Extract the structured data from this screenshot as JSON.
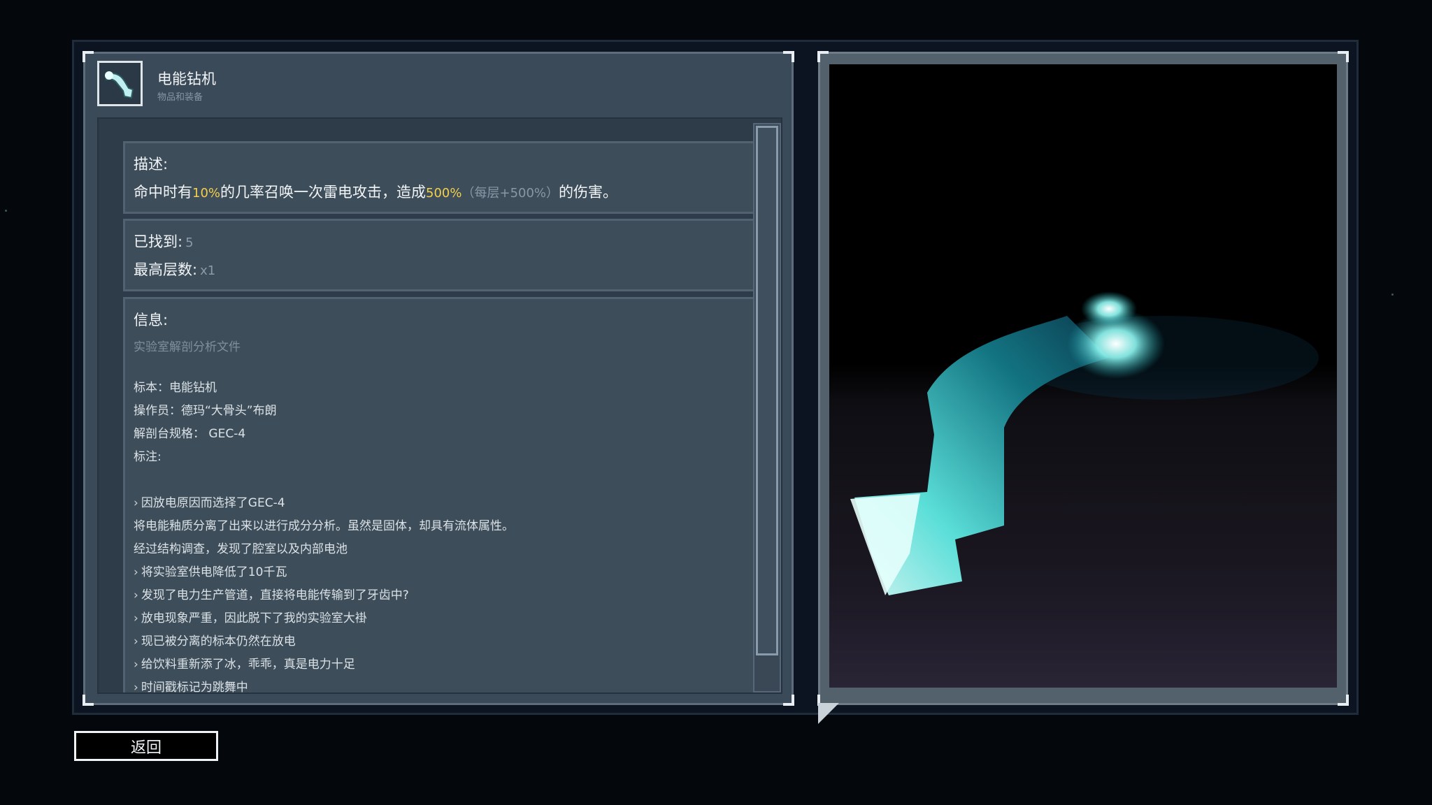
{
  "item": {
    "title": "电能钻机",
    "subtitle": "物品和装备",
    "icon": "electric-drill-icon"
  },
  "description": {
    "heading": "描述:",
    "text_a": "命中时有",
    "chance": "10%",
    "text_b": "的几率召唤一次雷电攻击，造成",
    "damage": "500%",
    "stack": "（每层+500%）",
    "text_c": "的伤害。"
  },
  "stats": {
    "found_label": "已找到:",
    "found_value": "5",
    "max_stack_label": "最高层数:",
    "max_stack_value": "x1"
  },
  "info": {
    "heading": "信息:",
    "subtitle": "实验室解剖分析文件",
    "lines": [
      "标本：电能钻机",
      "操作员：德玛“大骨头”布朗",
      "解剖台规格： GEC-4",
      "标注:"
    ],
    "notes": [
      {
        "arrow": true,
        "text": "因放电原因而选择了GEC-4"
      },
      {
        "arrow": false,
        "text": "将电能釉质分离了出来以进行成分分析。虽然是固体，却具有流体属性。"
      },
      {
        "arrow": false,
        "text": "经过结构调查，发现了腔室以及内部电池"
      },
      {
        "arrow": true,
        "text": "将实验室供电降低了10千瓦"
      },
      {
        "arrow": true,
        "text": "发现了电力生产管道，直接将电能传输到了牙齿中?"
      },
      {
        "arrow": true,
        "text": "放电现象严重，因此脱下了我的实验室大褂"
      },
      {
        "arrow": true,
        "text": "现已被分离的标本仍然在放电"
      },
      {
        "arrow": true,
        "text": "给饮料重新添了冰，乖乖，真是电力十足"
      },
      {
        "arrow": true,
        "text": "时间戳标记为跳舞中"
      }
    ]
  },
  "back_button": "返回",
  "colors": {
    "highlight": "#f3cf4a",
    "glow": "#4ff2e6"
  }
}
